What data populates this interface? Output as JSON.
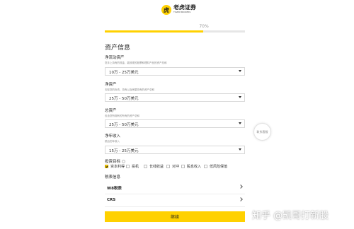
{
  "header": {
    "logo_text": "老虎证券",
    "logo_sub": "TIGER BROKERS",
    "logo_mark": "虎"
  },
  "progress": {
    "label": "70%",
    "value": 0.7
  },
  "section_title": "资产信息",
  "fields": [
    {
      "label": "净流动资产",
      "desc": "您手上持有的现金、能按现的股票和理财产品的资产总和",
      "value": "10万 - 25万美元"
    },
    {
      "label": "净资产",
      "desc": "去除您的负债、持有以及房屋持有的资产总和",
      "value": "25万 - 50万美元"
    },
    {
      "label": "总资产",
      "desc": "包含您所拥有的所有的资产总和",
      "value": "25万 - 50万美元"
    },
    {
      "label": "净年收入",
      "desc": "税后的年收入",
      "value": "15万 - 25万美元"
    }
  ],
  "investment_goals": {
    "label": "投资目标",
    "options": [
      {
        "label": "资本利得",
        "checked": true
      },
      {
        "label": "投机",
        "checked": false
      },
      {
        "label": "长线收益",
        "checked": false
      },
      {
        "label": "对冲",
        "checked": false
      },
      {
        "label": "股息收入",
        "checked": false
      },
      {
        "label": "低风险保值",
        "checked": false
      }
    ]
  },
  "tax_info": {
    "label": "税表信息",
    "rows": [
      {
        "label": "W8税表"
      },
      {
        "label": "CRS"
      }
    ]
  },
  "continue_label": "继续",
  "help_label": "联系客服",
  "watermark": "知乎 @凯哥打新股"
}
